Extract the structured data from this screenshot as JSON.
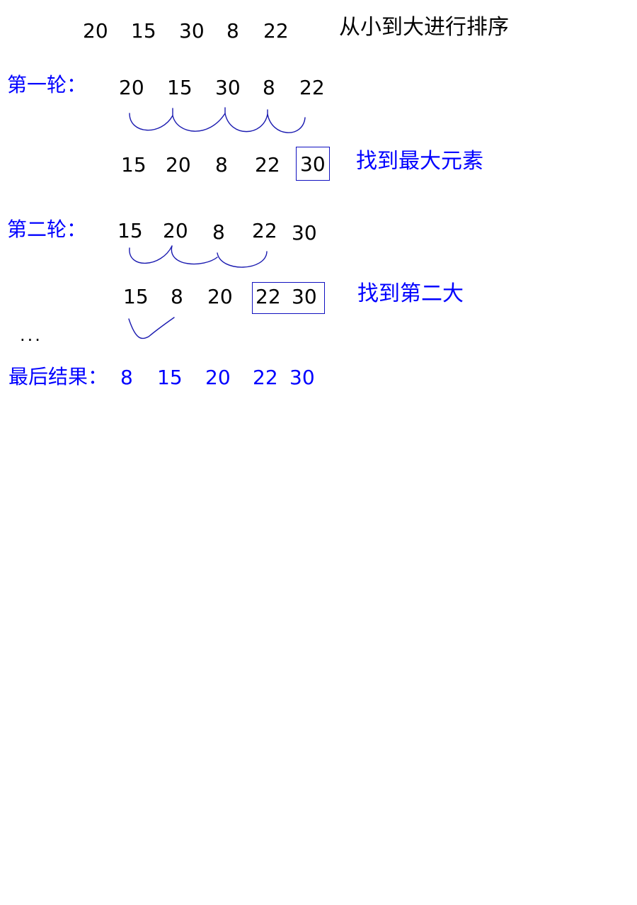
{
  "initial": {
    "numbers": [
      "20",
      "15",
      "30",
      "8",
      "22"
    ],
    "instruction": "从小到大进行排序"
  },
  "round1": {
    "label": "第一轮：",
    "before": [
      "20",
      "15",
      "30",
      "8",
      "22"
    ],
    "after": [
      "15",
      "20",
      "8",
      "22",
      "30"
    ],
    "note": "找到最大元素"
  },
  "round2": {
    "label": "第二轮：",
    "before": [
      "15",
      "20",
      "8",
      "22",
      "30"
    ],
    "after": [
      "15",
      "8",
      "20",
      "22",
      "30"
    ],
    "note": "找到第二大"
  },
  "ellipsis": "...",
  "result": {
    "label": "最后结果：",
    "numbers": [
      "8",
      "15",
      "20",
      "22",
      "30"
    ]
  },
  "colors": {
    "annotation": "#0000ff",
    "text": "#000000"
  }
}
